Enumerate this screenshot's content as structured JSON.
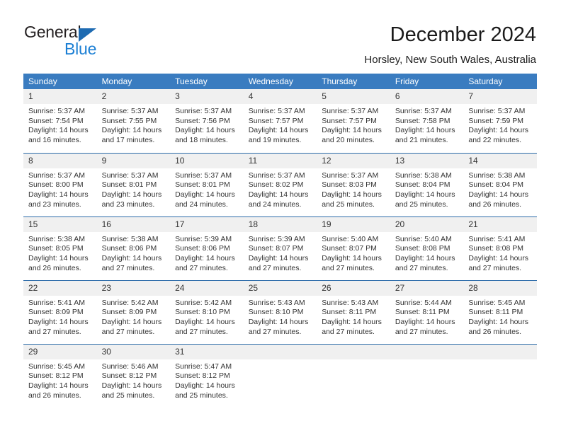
{
  "brand": {
    "name_primary": "General",
    "name_secondary": "Blue",
    "accent_color": "#1b7fd4",
    "triangle_color": "#1e6bb2"
  },
  "header": {
    "title": "December 2024",
    "subtitle": "Horsley, New South Wales, Australia"
  },
  "calendar": {
    "header_bg": "#3a7cc0",
    "row_divider_color": "#2a6aa8",
    "daynum_bg": "#f0f0f0",
    "weekday_headers": [
      "Sunday",
      "Monday",
      "Tuesday",
      "Wednesday",
      "Thursday",
      "Friday",
      "Saturday"
    ],
    "weeks": [
      [
        {
          "day": "1",
          "sunrise": "Sunrise: 5:37 AM",
          "sunset": "Sunset: 7:54 PM",
          "daylight": "Daylight: 14 hours and 16 minutes."
        },
        {
          "day": "2",
          "sunrise": "Sunrise: 5:37 AM",
          "sunset": "Sunset: 7:55 PM",
          "daylight": "Daylight: 14 hours and 17 minutes."
        },
        {
          "day": "3",
          "sunrise": "Sunrise: 5:37 AM",
          "sunset": "Sunset: 7:56 PM",
          "daylight": "Daylight: 14 hours and 18 minutes."
        },
        {
          "day": "4",
          "sunrise": "Sunrise: 5:37 AM",
          "sunset": "Sunset: 7:57 PM",
          "daylight": "Daylight: 14 hours and 19 minutes."
        },
        {
          "day": "5",
          "sunrise": "Sunrise: 5:37 AM",
          "sunset": "Sunset: 7:57 PM",
          "daylight": "Daylight: 14 hours and 20 minutes."
        },
        {
          "day": "6",
          "sunrise": "Sunrise: 5:37 AM",
          "sunset": "Sunset: 7:58 PM",
          "daylight": "Daylight: 14 hours and 21 minutes."
        },
        {
          "day": "7",
          "sunrise": "Sunrise: 5:37 AM",
          "sunset": "Sunset: 7:59 PM",
          "daylight": "Daylight: 14 hours and 22 minutes."
        }
      ],
      [
        {
          "day": "8",
          "sunrise": "Sunrise: 5:37 AM",
          "sunset": "Sunset: 8:00 PM",
          "daylight": "Daylight: 14 hours and 23 minutes."
        },
        {
          "day": "9",
          "sunrise": "Sunrise: 5:37 AM",
          "sunset": "Sunset: 8:01 PM",
          "daylight": "Daylight: 14 hours and 23 minutes."
        },
        {
          "day": "10",
          "sunrise": "Sunrise: 5:37 AM",
          "sunset": "Sunset: 8:01 PM",
          "daylight": "Daylight: 14 hours and 24 minutes."
        },
        {
          "day": "11",
          "sunrise": "Sunrise: 5:37 AM",
          "sunset": "Sunset: 8:02 PM",
          "daylight": "Daylight: 14 hours and 24 minutes."
        },
        {
          "day": "12",
          "sunrise": "Sunrise: 5:37 AM",
          "sunset": "Sunset: 8:03 PM",
          "daylight": "Daylight: 14 hours and 25 minutes."
        },
        {
          "day": "13",
          "sunrise": "Sunrise: 5:38 AM",
          "sunset": "Sunset: 8:04 PM",
          "daylight": "Daylight: 14 hours and 25 minutes."
        },
        {
          "day": "14",
          "sunrise": "Sunrise: 5:38 AM",
          "sunset": "Sunset: 8:04 PM",
          "daylight": "Daylight: 14 hours and 26 minutes."
        }
      ],
      [
        {
          "day": "15",
          "sunrise": "Sunrise: 5:38 AM",
          "sunset": "Sunset: 8:05 PM",
          "daylight": "Daylight: 14 hours and 26 minutes."
        },
        {
          "day": "16",
          "sunrise": "Sunrise: 5:38 AM",
          "sunset": "Sunset: 8:06 PM",
          "daylight": "Daylight: 14 hours and 27 minutes."
        },
        {
          "day": "17",
          "sunrise": "Sunrise: 5:39 AM",
          "sunset": "Sunset: 8:06 PM",
          "daylight": "Daylight: 14 hours and 27 minutes."
        },
        {
          "day": "18",
          "sunrise": "Sunrise: 5:39 AM",
          "sunset": "Sunset: 8:07 PM",
          "daylight": "Daylight: 14 hours and 27 minutes."
        },
        {
          "day": "19",
          "sunrise": "Sunrise: 5:40 AM",
          "sunset": "Sunset: 8:07 PM",
          "daylight": "Daylight: 14 hours and 27 minutes."
        },
        {
          "day": "20",
          "sunrise": "Sunrise: 5:40 AM",
          "sunset": "Sunset: 8:08 PM",
          "daylight": "Daylight: 14 hours and 27 minutes."
        },
        {
          "day": "21",
          "sunrise": "Sunrise: 5:41 AM",
          "sunset": "Sunset: 8:08 PM",
          "daylight": "Daylight: 14 hours and 27 minutes."
        }
      ],
      [
        {
          "day": "22",
          "sunrise": "Sunrise: 5:41 AM",
          "sunset": "Sunset: 8:09 PM",
          "daylight": "Daylight: 14 hours and 27 minutes."
        },
        {
          "day": "23",
          "sunrise": "Sunrise: 5:42 AM",
          "sunset": "Sunset: 8:09 PM",
          "daylight": "Daylight: 14 hours and 27 minutes."
        },
        {
          "day": "24",
          "sunrise": "Sunrise: 5:42 AM",
          "sunset": "Sunset: 8:10 PM",
          "daylight": "Daylight: 14 hours and 27 minutes."
        },
        {
          "day": "25",
          "sunrise": "Sunrise: 5:43 AM",
          "sunset": "Sunset: 8:10 PM",
          "daylight": "Daylight: 14 hours and 27 minutes."
        },
        {
          "day": "26",
          "sunrise": "Sunrise: 5:43 AM",
          "sunset": "Sunset: 8:11 PM",
          "daylight": "Daylight: 14 hours and 27 minutes."
        },
        {
          "day": "27",
          "sunrise": "Sunrise: 5:44 AM",
          "sunset": "Sunset: 8:11 PM",
          "daylight": "Daylight: 14 hours and 27 minutes."
        },
        {
          "day": "28",
          "sunrise": "Sunrise: 5:45 AM",
          "sunset": "Sunset: 8:11 PM",
          "daylight": "Daylight: 14 hours and 26 minutes."
        }
      ],
      [
        {
          "day": "29",
          "sunrise": "Sunrise: 5:45 AM",
          "sunset": "Sunset: 8:12 PM",
          "daylight": "Daylight: 14 hours and 26 minutes."
        },
        {
          "day": "30",
          "sunrise": "Sunrise: 5:46 AM",
          "sunset": "Sunset: 8:12 PM",
          "daylight": "Daylight: 14 hours and 25 minutes."
        },
        {
          "day": "31",
          "sunrise": "Sunrise: 5:47 AM",
          "sunset": "Sunset: 8:12 PM",
          "daylight": "Daylight: 14 hours and 25 minutes."
        },
        {
          "day": "",
          "sunrise": "",
          "sunset": "",
          "daylight": ""
        },
        {
          "day": "",
          "sunrise": "",
          "sunset": "",
          "daylight": ""
        },
        {
          "day": "",
          "sunrise": "",
          "sunset": "",
          "daylight": ""
        },
        {
          "day": "",
          "sunrise": "",
          "sunset": "",
          "daylight": ""
        }
      ]
    ]
  }
}
